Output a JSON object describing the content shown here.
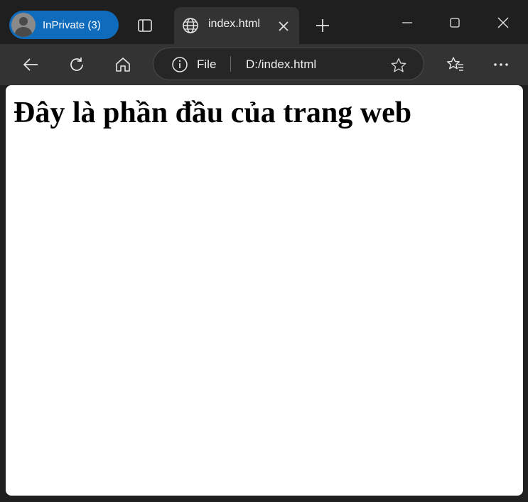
{
  "profile": {
    "label": "InPrivate (3)"
  },
  "tab": {
    "title": "index.html"
  },
  "address_bar": {
    "scheme_label": "File",
    "url": "D:/index.html"
  },
  "page": {
    "heading": "Đây là phần đầu của trang web"
  },
  "icons": {
    "tab_actions": "tab-actions-icon",
    "globe": "globe-icon",
    "close_tab": "close-icon",
    "new_tab": "plus-icon",
    "minimize": "minimize-icon",
    "maximize": "maximize-icon",
    "close_window": "close-icon",
    "back": "back-arrow-icon",
    "refresh": "refresh-icon",
    "home": "home-icon",
    "info": "info-icon",
    "favorite": "star-icon",
    "favorites": "favorites-icon",
    "more": "more-icon"
  },
  "colors": {
    "profile_pill": "#0f6cbd",
    "frame": "#1f1f1f",
    "toolbar": "#333333",
    "page_background": "#ffffff"
  }
}
